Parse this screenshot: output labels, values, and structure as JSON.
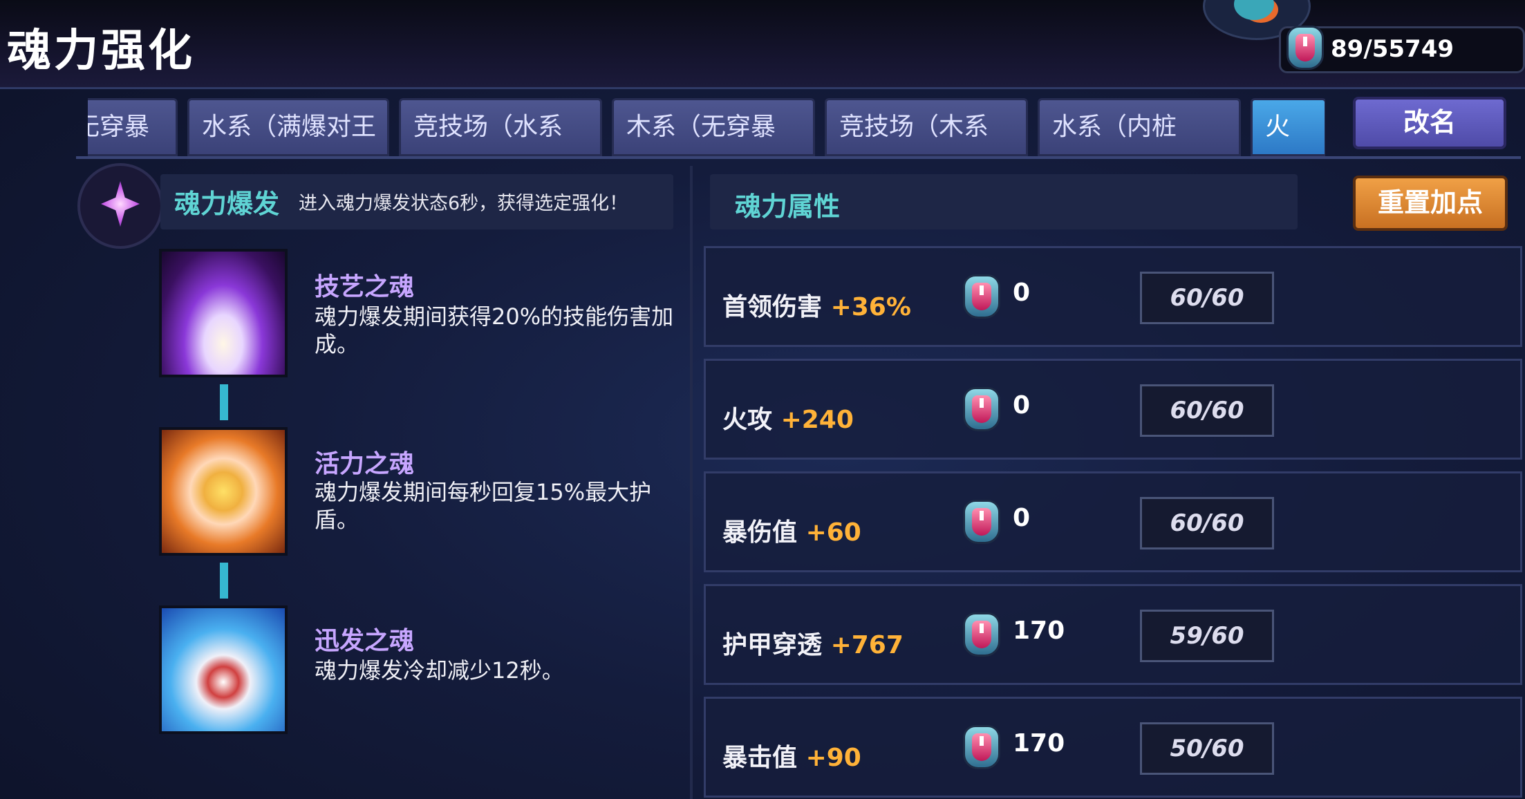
{
  "header": {
    "title": "魂力强化",
    "currency_value": "89/55749"
  },
  "tabs": [
    {
      "label": "无穿暴"
    },
    {
      "label": "水系（满爆对王"
    },
    {
      "label": "竞技场（水系"
    },
    {
      "label": "木系（无穿暴"
    },
    {
      "label": "竞技场（木系"
    },
    {
      "label": "水系（内桩"
    },
    {
      "label": "火"
    }
  ],
  "buttons": {
    "rename": "改名",
    "reset": "重置加点"
  },
  "soul_burst": {
    "title": "魂力爆发",
    "desc": "进入魂力爆发状态6秒，获得选定强化！"
  },
  "skills": [
    {
      "name": "技艺之魂",
      "desc": "魂力爆发期间获得20%的技能伤害加成。"
    },
    {
      "name": "活力之魂",
      "desc": "魂力爆发期间每秒回复15%最大护盾。"
    },
    {
      "name": "迅发之魂",
      "desc": "魂力爆发冷却减少12秒。"
    }
  ],
  "attributes": {
    "title": "魂力属性",
    "rows": [
      {
        "label": "首领伤害",
        "bonus": "+36%",
        "cost": "0",
        "progress": "60/60"
      },
      {
        "label": "火攻",
        "bonus": "+240",
        "cost": "0",
        "progress": "60/60"
      },
      {
        "label": "暴伤值",
        "bonus": "+60",
        "cost": "0",
        "progress": "60/60"
      },
      {
        "label": "护甲穿透",
        "bonus": "+767",
        "cost": "170",
        "progress": "59/60"
      },
      {
        "label": "暴击值",
        "bonus": "+90",
        "cost": "170",
        "progress": "50/60"
      }
    ]
  },
  "colors": {
    "accent_teal": "#5fd4d4",
    "bonus_orange": "#ffb238",
    "skill_name": "#c7a6ff",
    "active_tab": "#3a92d8",
    "reset_button": "#e08a34"
  }
}
